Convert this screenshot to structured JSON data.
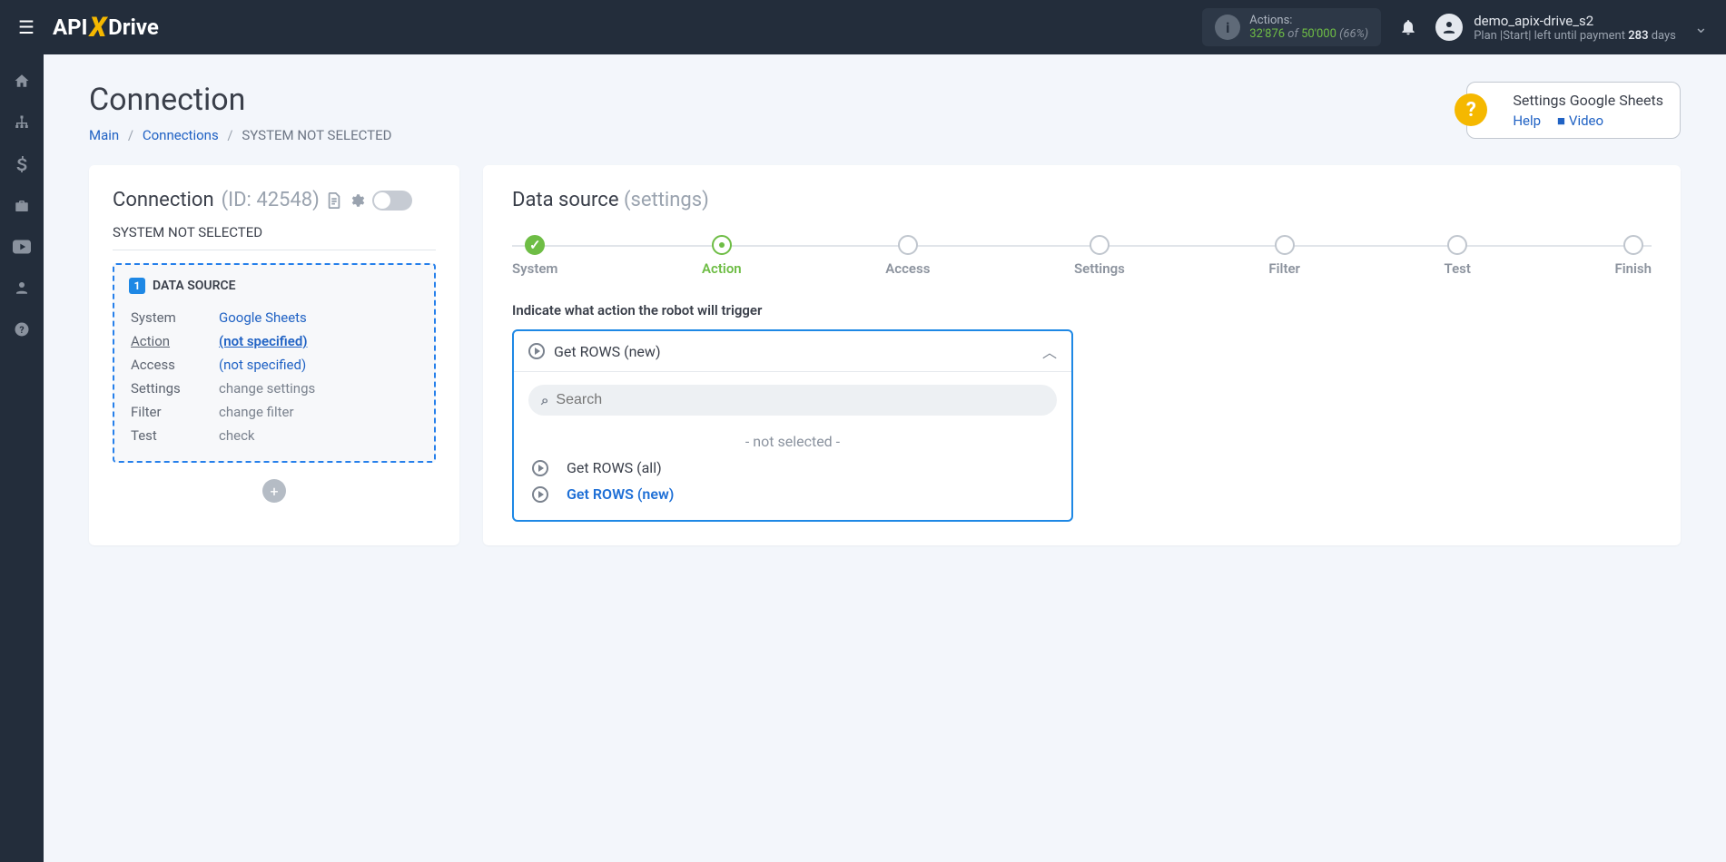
{
  "topbar": {
    "actions_label": "Actions:",
    "actions_used": "32'876",
    "actions_of": " of ",
    "actions_total": "50'000",
    "actions_pct": " (66%)",
    "user_name": "demo_apix-drive_s2",
    "user_plan_prefix": "Plan |Start| left until payment ",
    "user_plan_days_num": "283",
    "user_plan_days_suffix": " days"
  },
  "page": {
    "title": "Connection",
    "breadcrumb": {
      "main": "Main",
      "connections": "Connections",
      "current": "SYSTEM NOT SELECTED"
    }
  },
  "help": {
    "title": "Settings Google Sheets",
    "help_label": "Help",
    "video_label": "Video"
  },
  "left": {
    "head_label": "Connection ",
    "head_id": "(ID: 42548)",
    "subhead": "SYSTEM NOT SELECTED",
    "section_title": "DATA SOURCE",
    "rows": {
      "system_label": "System",
      "system_value": "Google Sheets",
      "action_label": "Action",
      "action_value": "(not specified)",
      "access_label": "Access",
      "access_value": "(not specified)",
      "settings_label": "Settings",
      "settings_value": "change settings",
      "filter_label": "Filter",
      "filter_value": "change filter",
      "test_label": "Test",
      "test_value": "check"
    }
  },
  "right": {
    "title_main": "Data source ",
    "title_sub": "(settings)",
    "steps": [
      "System",
      "Action",
      "Access",
      "Settings",
      "Filter",
      "Test",
      "Finish"
    ],
    "prompt": "Indicate what action the robot will trigger",
    "dropdown_selected": "Get ROWS (new)",
    "search_placeholder": "Search",
    "options": {
      "not_selected": "- not selected -",
      "opt1": "Get ROWS (all)",
      "opt2": "Get ROWS (new)"
    }
  }
}
